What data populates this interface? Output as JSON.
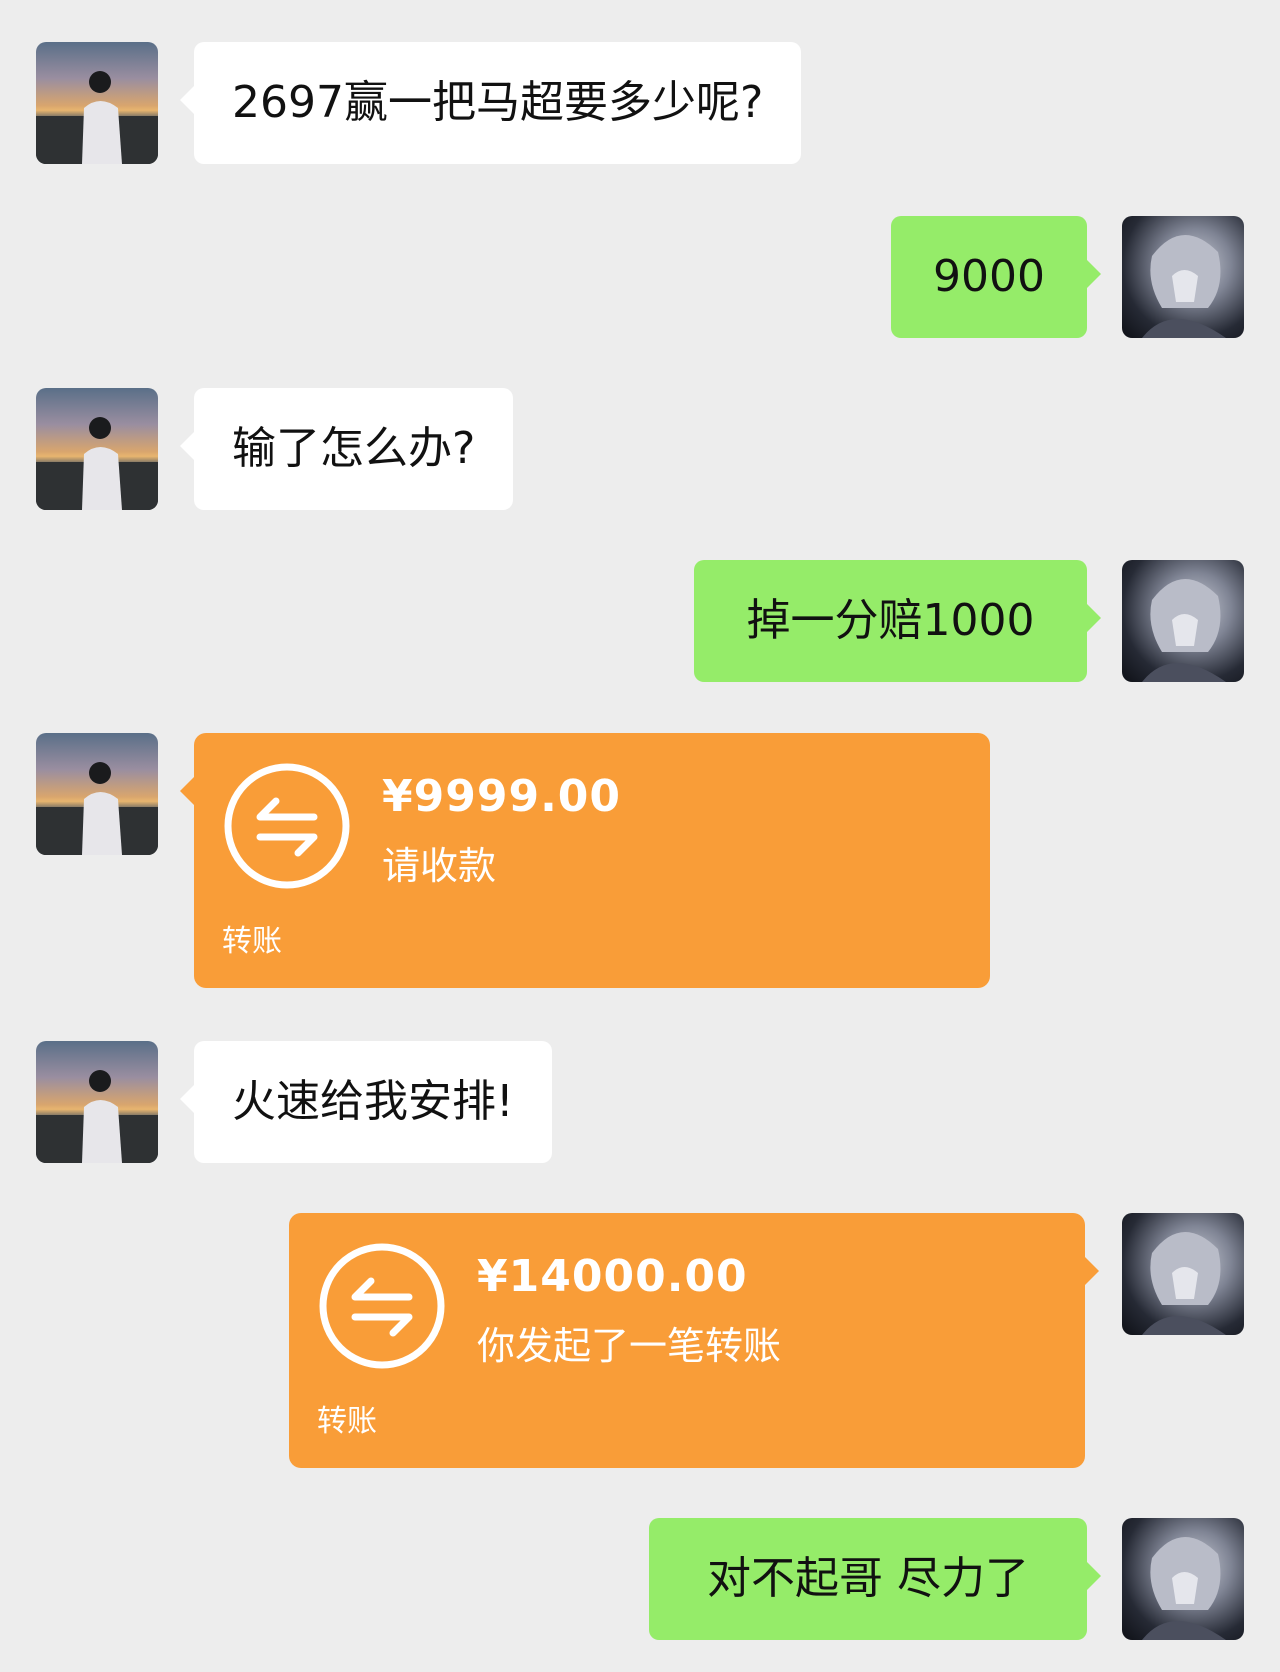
{
  "conversation": {
    "messages": [
      {
        "side": "left",
        "type": "text",
        "text": "2697赢一把马超要多少呢?"
      },
      {
        "side": "right",
        "type": "text",
        "text": "9000"
      },
      {
        "side": "left",
        "type": "text",
        "text": "输了怎么办?"
      },
      {
        "side": "right",
        "type": "text",
        "text": "掉一分赔1000"
      },
      {
        "side": "left",
        "type": "transfer",
        "amount": "¥9999.00",
        "desc": "请收款",
        "label": "转账"
      },
      {
        "side": "left",
        "type": "text",
        "text": "火速给我安排!"
      },
      {
        "side": "right",
        "type": "transfer",
        "amount": "¥14000.00",
        "desc": "你发起了一笔转账",
        "label": "转账"
      },
      {
        "side": "right",
        "type": "text",
        "text": "对不起哥 尽力了"
      }
    ]
  },
  "colors": {
    "background": "#ededed",
    "incoming_bubble": "#ffffff",
    "outgoing_bubble": "#95ec69",
    "transfer_card": "#f99d38"
  },
  "icons": {
    "transfer": "transfer-arrows-icon",
    "left_avatar": "avatar-sunset-silhouette",
    "right_avatar": "avatar-anime-character"
  }
}
